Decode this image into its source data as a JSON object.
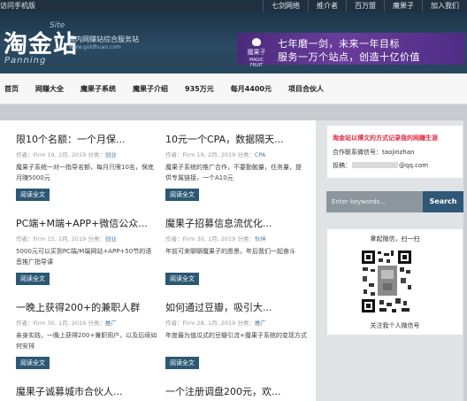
{
  "topbar": {
    "mobile": "访问手机版",
    "links": [
      "七剑网络",
      "推介者",
      "百万盟",
      "魔果子",
      "加入我们"
    ]
  },
  "logo": {
    "main": "淘金站",
    "site": "Site",
    "panning": "Panning",
    "slogan": "国内网赚站综合服务站",
    "url": "www.goldhuan.com"
  },
  "banner": {
    "brand": "魔果子",
    "brand_en": "MAGIC FRUIT",
    "line1": "七年磨一剑，未来一年目标",
    "line2": "服务一万个站点，创造十亿价值"
  },
  "nav": [
    "首页",
    "网赚大全",
    "魔果子系统",
    "魔果子介绍",
    "935万元",
    "每月4400元",
    "项目合伙人"
  ],
  "posts": [
    {
      "title": "限10个名额：一个月保...",
      "author": "Firm",
      "date": "19, 2月, 2019",
      "cat": "创业",
      "excerpt": "魔果子系统一对一指导名额，每月只限10名，保底月赚5000元",
      "btn": "阅读全文"
    },
    {
      "title": "10元一个CPA，数据隔天...",
      "author": "Firm",
      "date": "19, 2月, 2019",
      "cat": "CPA",
      "excerpt": "魔果子系统的推广合作，不要勤勉量，任务量，提供专属链接，一个A10元",
      "btn": "阅读全文"
    },
    {
      "title": "PC端+M端+APP+微信公众...",
      "author": "Firm",
      "date": "15, 2月, 2019",
      "cat": "创业",
      "excerpt": "5000元可以买到PC端/M端网站+APP+50节的语音推广指导课",
      "btn": "阅读全文"
    },
    {
      "title": "魔果子招募信息流优化...",
      "author": "Firm",
      "date": "30, 1月, 2019",
      "cat": "伙伴",
      "excerpt": "年前可来聊聊魔果子的愿景，年后我们一起奋斗",
      "btn": "阅读全文"
    },
    {
      "title": "一晚上获得200+的兼职人群",
      "author": "Firm",
      "date": "30, 1月, 2019",
      "cat": "推广",
      "excerpt": "亲身实践，一晚上获得200+兼职用户，以及后续如何安排",
      "btn": "阅读全文"
    },
    {
      "title": "如何通过豆瓣，吸引大...",
      "author": "Firm",
      "date": "28, 1月, 2019",
      "cat": "推广",
      "excerpt": "年度最为值瓜式的豆瓣引流+魔果子系统的变现方式",
      "btn": "阅读全文"
    },
    {
      "title": "魔果子诚募城市合伙人...",
      "author": "",
      "date": "",
      "cat": "",
      "excerpt": "",
      "btn": ""
    },
    {
      "title": "一个注册调盘200元，欢...",
      "author": "",
      "date": "",
      "cat": "",
      "excerpt": "",
      "btn": ""
    }
  ],
  "meta_labels": {
    "author": "作者：",
    "category": "分类："
  },
  "sidebar": {
    "notice": "淘金站以博文的方式记录我的网赚生涯",
    "wechat": "合作联系微信号：taojinzhan",
    "mail_prefix": "投稿：",
    "mail_suffix": "@qq.com",
    "search_placeholder": "Enter keywords...",
    "search_button": "Search",
    "qr_title": "拿起微信，扫一扫",
    "qr_caption": "关注我个人微信号"
  },
  "colors": {
    "header_bg": "#1d3447",
    "button_bg": "#2c5874",
    "notice_red": "#e3283f",
    "banner_purple": "#5a3490"
  }
}
